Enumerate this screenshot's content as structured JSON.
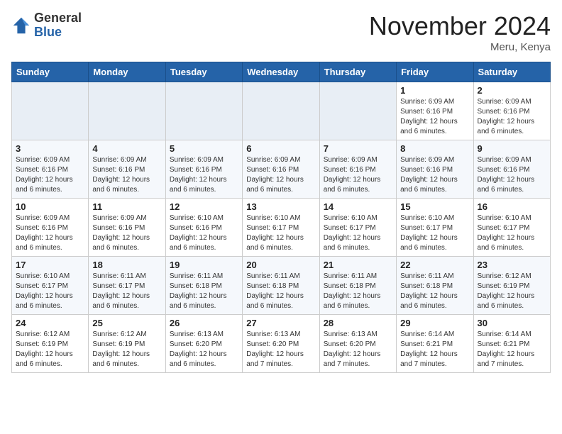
{
  "logo": {
    "general": "General",
    "blue": "Blue"
  },
  "title": "November 2024",
  "location": "Meru, Kenya",
  "weekdays": [
    "Sunday",
    "Monday",
    "Tuesday",
    "Wednesday",
    "Thursday",
    "Friday",
    "Saturday"
  ],
  "weeks": [
    [
      {
        "day": null,
        "info": ""
      },
      {
        "day": null,
        "info": ""
      },
      {
        "day": null,
        "info": ""
      },
      {
        "day": null,
        "info": ""
      },
      {
        "day": null,
        "info": ""
      },
      {
        "day": "1",
        "info": "Sunrise: 6:09 AM\nSunset: 6:16 PM\nDaylight: 12 hours and 6 minutes."
      },
      {
        "day": "2",
        "info": "Sunrise: 6:09 AM\nSunset: 6:16 PM\nDaylight: 12 hours and 6 minutes."
      }
    ],
    [
      {
        "day": "3",
        "info": "Sunrise: 6:09 AM\nSunset: 6:16 PM\nDaylight: 12 hours and 6 minutes."
      },
      {
        "day": "4",
        "info": "Sunrise: 6:09 AM\nSunset: 6:16 PM\nDaylight: 12 hours and 6 minutes."
      },
      {
        "day": "5",
        "info": "Sunrise: 6:09 AM\nSunset: 6:16 PM\nDaylight: 12 hours and 6 minutes."
      },
      {
        "day": "6",
        "info": "Sunrise: 6:09 AM\nSunset: 6:16 PM\nDaylight: 12 hours and 6 minutes."
      },
      {
        "day": "7",
        "info": "Sunrise: 6:09 AM\nSunset: 6:16 PM\nDaylight: 12 hours and 6 minutes."
      },
      {
        "day": "8",
        "info": "Sunrise: 6:09 AM\nSunset: 6:16 PM\nDaylight: 12 hours and 6 minutes."
      },
      {
        "day": "9",
        "info": "Sunrise: 6:09 AM\nSunset: 6:16 PM\nDaylight: 12 hours and 6 minutes."
      }
    ],
    [
      {
        "day": "10",
        "info": "Sunrise: 6:09 AM\nSunset: 6:16 PM\nDaylight: 12 hours and 6 minutes."
      },
      {
        "day": "11",
        "info": "Sunrise: 6:09 AM\nSunset: 6:16 PM\nDaylight: 12 hours and 6 minutes."
      },
      {
        "day": "12",
        "info": "Sunrise: 6:10 AM\nSunset: 6:16 PM\nDaylight: 12 hours and 6 minutes."
      },
      {
        "day": "13",
        "info": "Sunrise: 6:10 AM\nSunset: 6:17 PM\nDaylight: 12 hours and 6 minutes."
      },
      {
        "day": "14",
        "info": "Sunrise: 6:10 AM\nSunset: 6:17 PM\nDaylight: 12 hours and 6 minutes."
      },
      {
        "day": "15",
        "info": "Sunrise: 6:10 AM\nSunset: 6:17 PM\nDaylight: 12 hours and 6 minutes."
      },
      {
        "day": "16",
        "info": "Sunrise: 6:10 AM\nSunset: 6:17 PM\nDaylight: 12 hours and 6 minutes."
      }
    ],
    [
      {
        "day": "17",
        "info": "Sunrise: 6:10 AM\nSunset: 6:17 PM\nDaylight: 12 hours and 6 minutes."
      },
      {
        "day": "18",
        "info": "Sunrise: 6:11 AM\nSunset: 6:17 PM\nDaylight: 12 hours and 6 minutes."
      },
      {
        "day": "19",
        "info": "Sunrise: 6:11 AM\nSunset: 6:18 PM\nDaylight: 12 hours and 6 minutes."
      },
      {
        "day": "20",
        "info": "Sunrise: 6:11 AM\nSunset: 6:18 PM\nDaylight: 12 hours and 6 minutes."
      },
      {
        "day": "21",
        "info": "Sunrise: 6:11 AM\nSunset: 6:18 PM\nDaylight: 12 hours and 6 minutes."
      },
      {
        "day": "22",
        "info": "Sunrise: 6:11 AM\nSunset: 6:18 PM\nDaylight: 12 hours and 6 minutes."
      },
      {
        "day": "23",
        "info": "Sunrise: 6:12 AM\nSunset: 6:19 PM\nDaylight: 12 hours and 6 minutes."
      }
    ],
    [
      {
        "day": "24",
        "info": "Sunrise: 6:12 AM\nSunset: 6:19 PM\nDaylight: 12 hours and 6 minutes."
      },
      {
        "day": "25",
        "info": "Sunrise: 6:12 AM\nSunset: 6:19 PM\nDaylight: 12 hours and 6 minutes."
      },
      {
        "day": "26",
        "info": "Sunrise: 6:13 AM\nSunset: 6:20 PM\nDaylight: 12 hours and 6 minutes."
      },
      {
        "day": "27",
        "info": "Sunrise: 6:13 AM\nSunset: 6:20 PM\nDaylight: 12 hours and 7 minutes."
      },
      {
        "day": "28",
        "info": "Sunrise: 6:13 AM\nSunset: 6:20 PM\nDaylight: 12 hours and 7 minutes."
      },
      {
        "day": "29",
        "info": "Sunrise: 6:14 AM\nSunset: 6:21 PM\nDaylight: 12 hours and 7 minutes."
      },
      {
        "day": "30",
        "info": "Sunrise: 6:14 AM\nSunset: 6:21 PM\nDaylight: 12 hours and 7 minutes."
      }
    ]
  ]
}
